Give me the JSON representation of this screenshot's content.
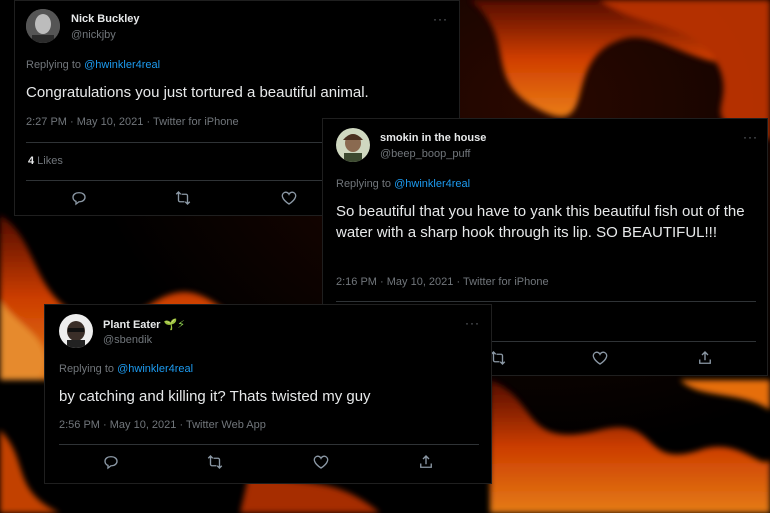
{
  "tweets": [
    {
      "name": "Nick Buckley",
      "handle": "@nickjby",
      "more": "···",
      "replying_prefix": "Replying to ",
      "replying_to": "@hwinkler4real",
      "text": "Congratulations you just tortured a beautiful animal.",
      "meta": "2:27 PM · May 10, 2021 · Twitter for iPhone",
      "likes_count": "4",
      "likes_label": " Likes"
    },
    {
      "name": "smokin in the house",
      "handle": "@beep_boop_puff",
      "more": "···",
      "replying_prefix": "Replying to ",
      "replying_to": "@hwinkler4real",
      "text": "So beautiful that you have to yank this beautiful fish out of the water with a sharp hook through its lip. SO BEAUTIFUL!!!",
      "meta": "2:16 PM · May 10, 2021 · Twitter for iPhone"
    },
    {
      "name": "Plant Eater",
      "name_emoji": "🌱⚡",
      "handle": "@sbendik",
      "more": "···",
      "replying_prefix": "Replying to ",
      "replying_to": "@hwinkler4real",
      "text": "by catching and killing it? Thats twisted my guy",
      "meta": "2:56 PM · May 10, 2021 · Twitter Web App"
    }
  ],
  "icons": {
    "reply": "reply-icon",
    "retweet": "retweet-icon",
    "like": "heart-icon",
    "share": "share-icon"
  },
  "colors": {
    "link": "#1d9bf0",
    "secondary_text": "#71767b",
    "primary_text": "#e7e9ea"
  }
}
